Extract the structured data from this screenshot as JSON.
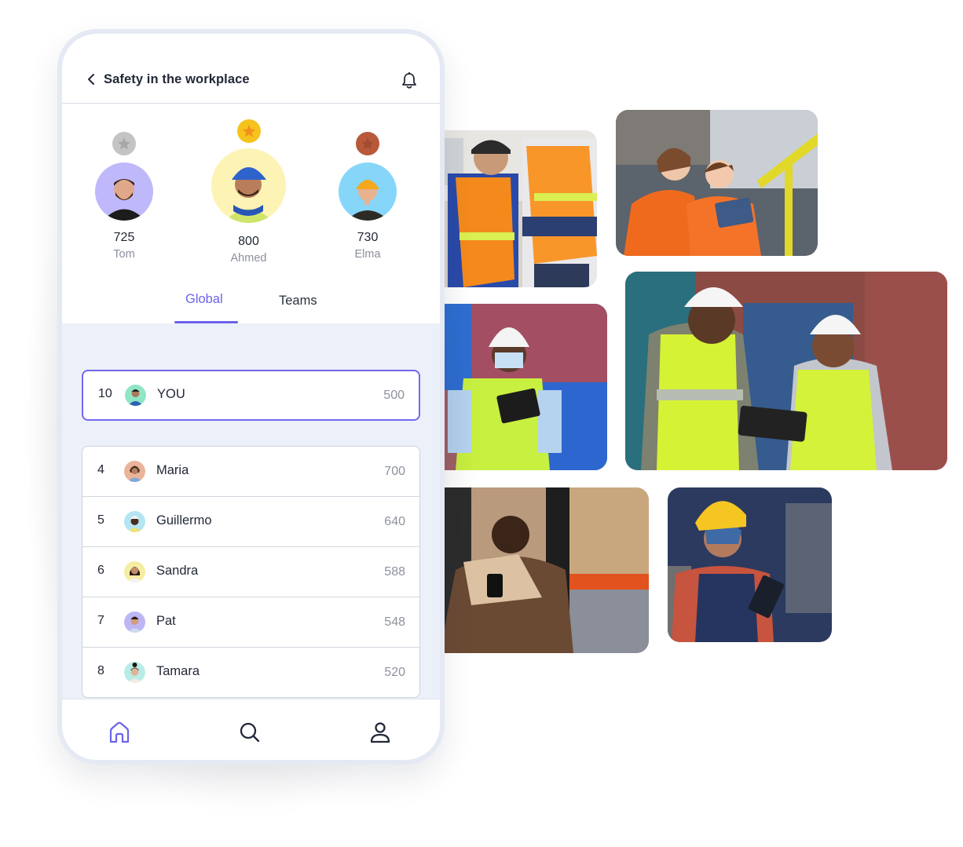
{
  "header": {
    "back_icon": "chevron-left-icon",
    "title": "Safety in the workplace",
    "bell_icon": "bell-icon"
  },
  "podium": [
    {
      "place": 2,
      "medal": "silver",
      "medal_color": "#c4c4c4",
      "avatar_bg": "#bfb8fb",
      "score": "725",
      "name": "Tom"
    },
    {
      "place": 1,
      "medal": "gold",
      "medal_color": "#f6c21c",
      "avatar_bg": "#fdf3b4",
      "score": "800",
      "name": "Ahmed"
    },
    {
      "place": 3,
      "medal": "bronze",
      "medal_color": "#b8593a",
      "avatar_bg": "#86d6f9",
      "score": "730",
      "name": "Elma"
    }
  ],
  "tabs": [
    {
      "label": "Global",
      "active": true
    },
    {
      "label": "Teams",
      "active": false
    }
  ],
  "current_user": {
    "rank": "10",
    "name": "YOU",
    "score": "500",
    "avatar_bg": "#8fe6c6"
  },
  "leaderboard": [
    {
      "rank": "4",
      "name": "Maria",
      "score": "700",
      "avatar_bg": "#eab49a"
    },
    {
      "rank": "5",
      "name": "Guillermo",
      "score": "640",
      "avatar_bg": "#b5e4f2"
    },
    {
      "rank": "6",
      "name": "Sandra",
      "score": "588",
      "avatar_bg": "#f6eca2"
    },
    {
      "rank": "7",
      "name": "Pat",
      "score": "548",
      "avatar_bg": "#bdb6f5"
    },
    {
      "rank": "8",
      "name": "Tamara",
      "score": "520",
      "avatar_bg": "#b9ece6"
    }
  ],
  "bottom_nav": [
    {
      "icon": "home-icon",
      "active": true
    },
    {
      "icon": "search-icon",
      "active": false
    },
    {
      "icon": "profile-icon",
      "active": false
    }
  ],
  "accent_color": "#6c63ea",
  "photos": [
    {
      "subject": "two workers in orange vests reviewing a tablet"
    },
    {
      "subject": "two women in orange coveralls with a tablet"
    },
    {
      "subject": "worker in hard hat and mask with tablet at shipping containers"
    },
    {
      "subject": "two workers in hi-vis vests and hard hats reviewing a tablet"
    },
    {
      "subject": "forklift operator using a phone in a warehouse"
    },
    {
      "subject": "woman in yellow hard hat with a tablet"
    }
  ]
}
